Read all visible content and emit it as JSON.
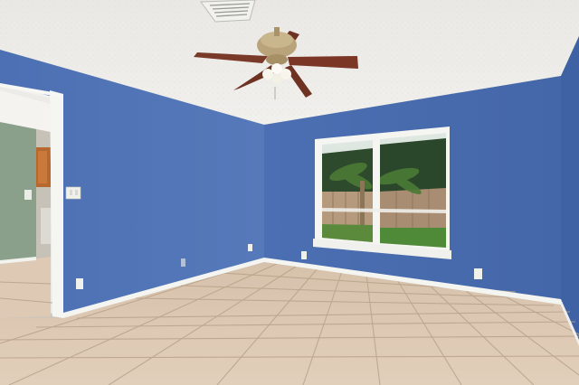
{
  "scene": {
    "description_colors": {
      "wall": "#4f73b5",
      "wall_shadow": "#3f5f9e",
      "ceiling": "#ecebe8",
      "floor": "#d8c3ad",
      "grout": "#b9a28b",
      "trim": "#f3f3f0",
      "hall_wall": "#8aa08a",
      "fan_blade": "#7a3a2a",
      "fan_metal": "#b9a37a"
    },
    "icons": {
      "ceiling_fan": "ceiling-fan-icon",
      "air_vent": "air-vent-icon",
      "light_switch": "light-switch-icon",
      "outlet": "electrical-outlet-icon"
    }
  }
}
